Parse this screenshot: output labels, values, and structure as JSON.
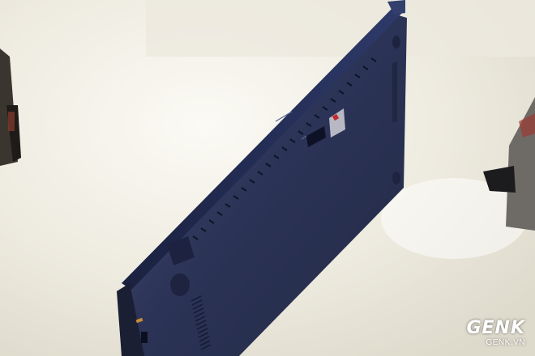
{
  "watermark": {
    "logo": "GENK",
    "site": "GENK.VN"
  },
  "colors": {
    "background": "#f1efe6",
    "laptop_body": "#2a3252",
    "laptop_edge": "#1a1f35"
  }
}
